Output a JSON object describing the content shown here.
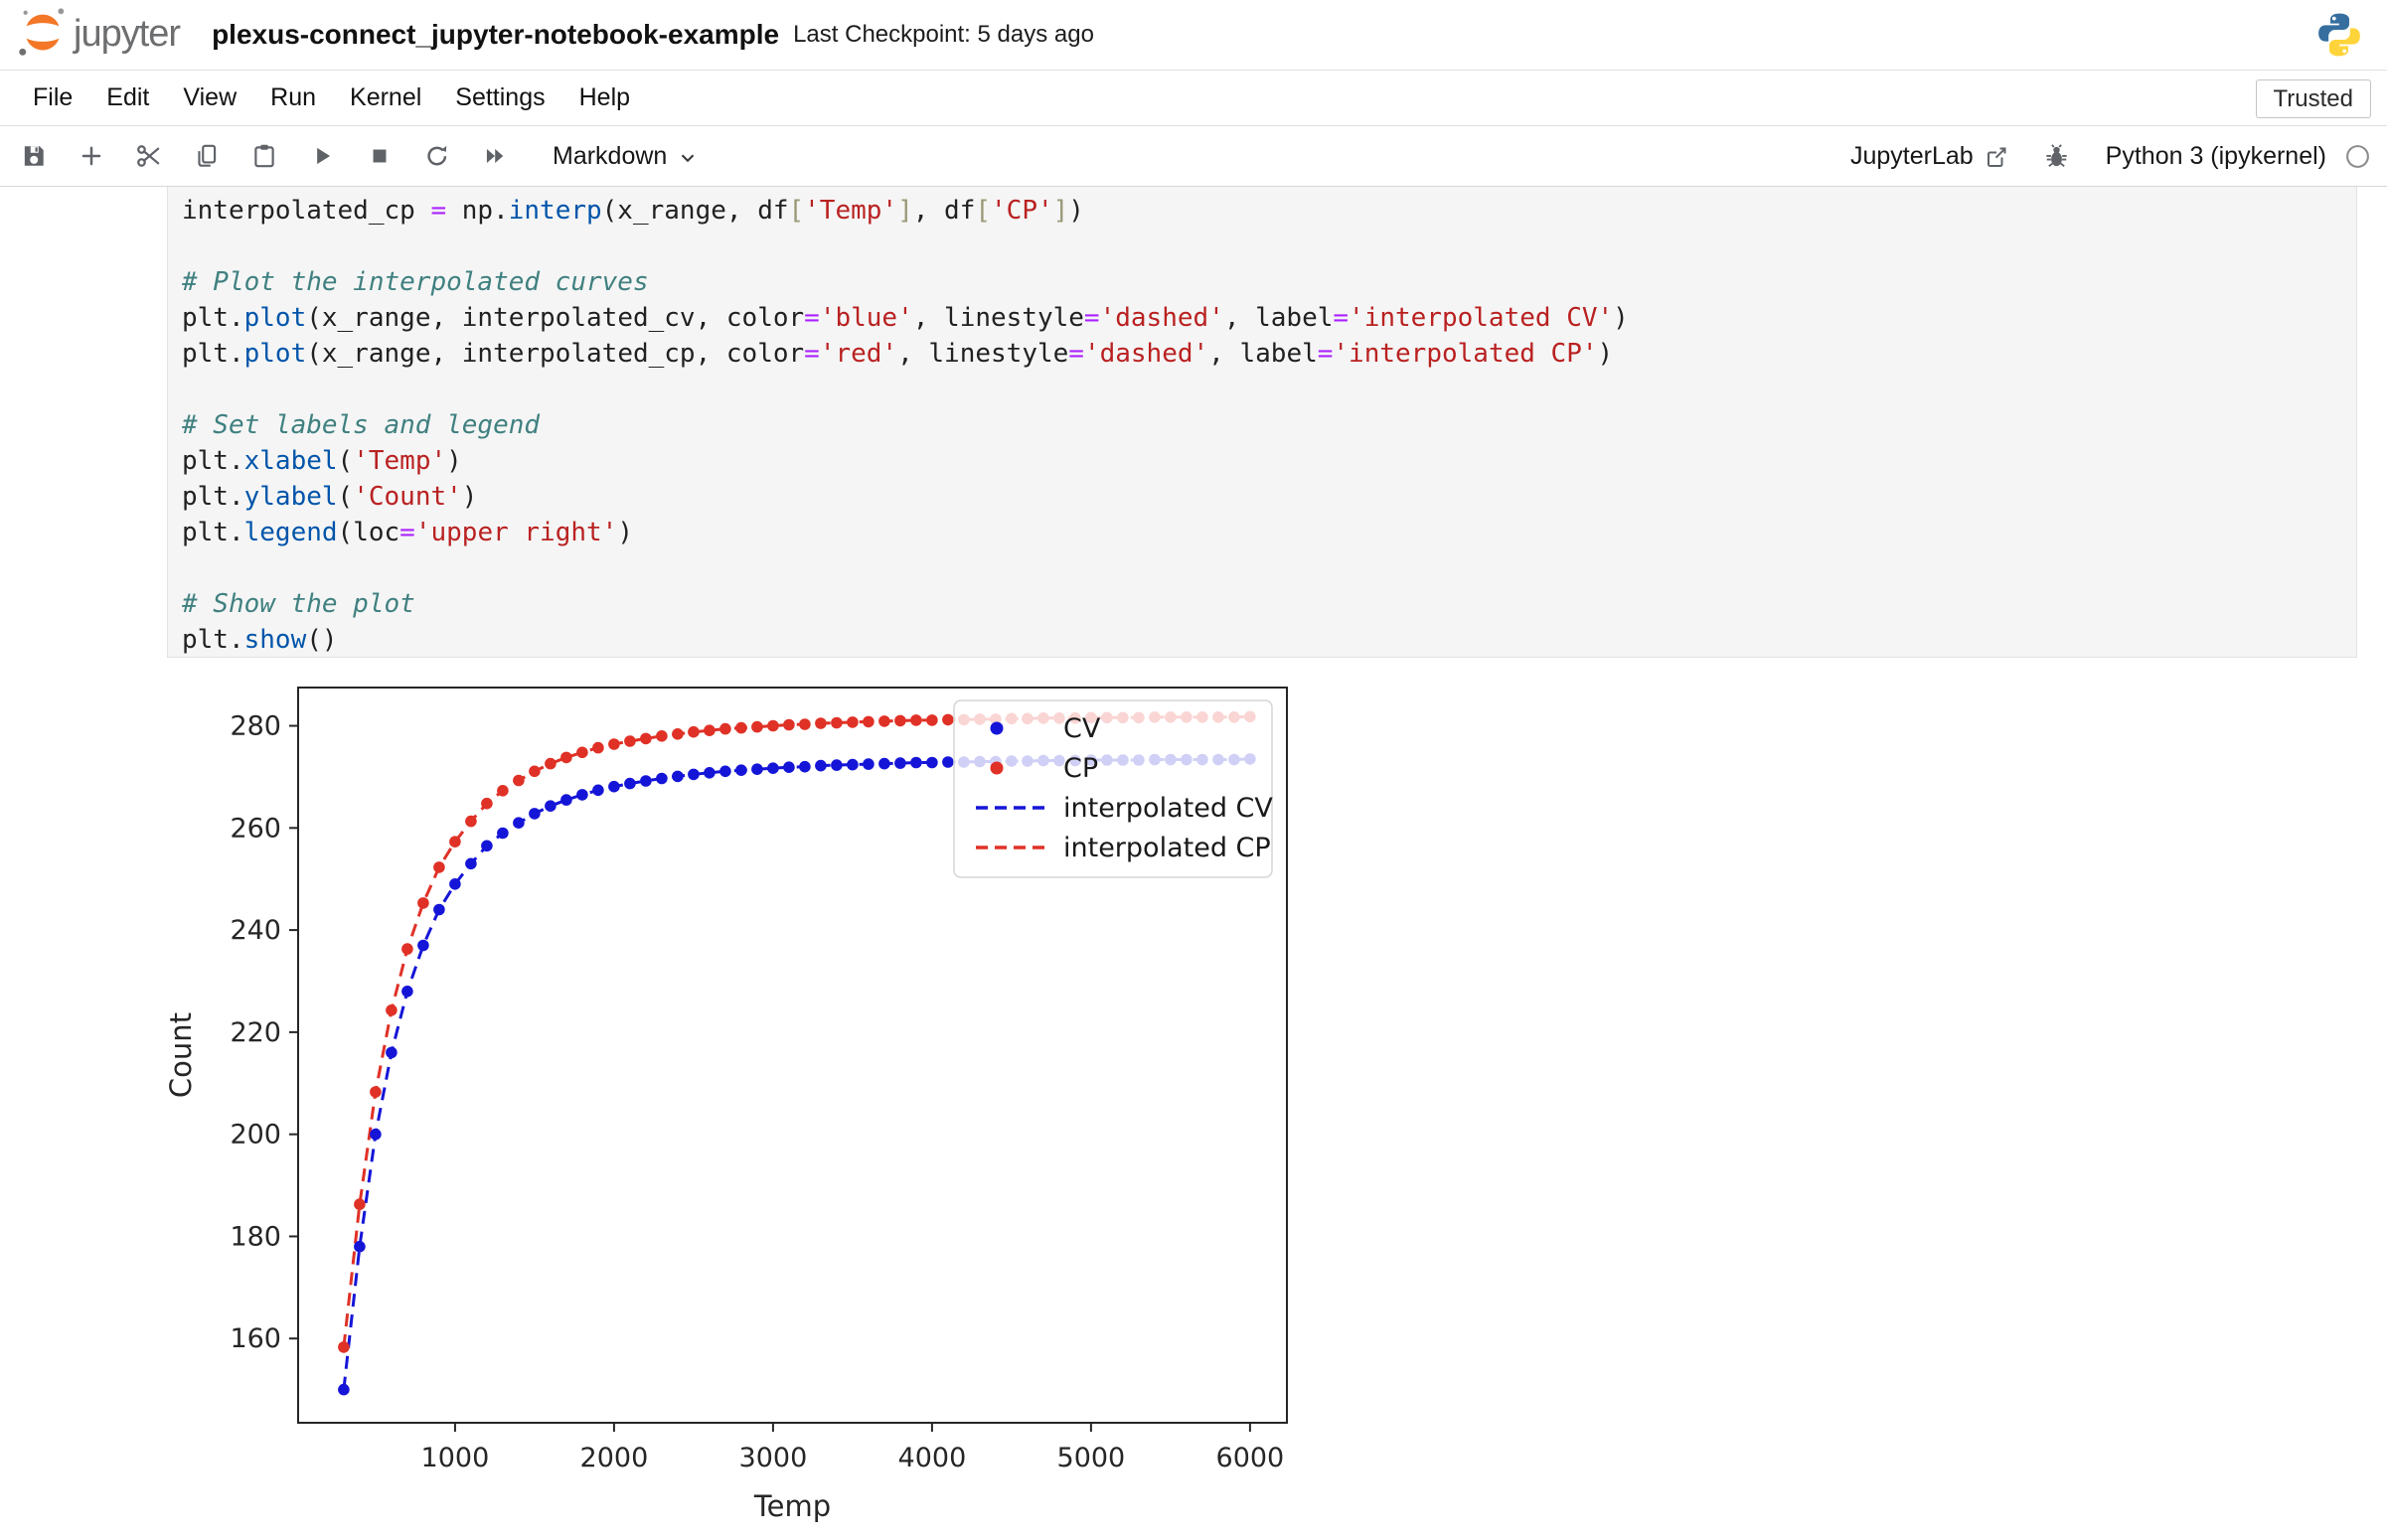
{
  "header": {
    "logo_text": "jupyter",
    "title": "plexus-connect_jupyter-notebook-example",
    "checkpoint": "Last Checkpoint: 5 days ago"
  },
  "menu": {
    "items": [
      "File",
      "Edit",
      "View",
      "Run",
      "Kernel",
      "Settings",
      "Help"
    ],
    "trusted_label": "Trusted"
  },
  "toolbar": {
    "icons": [
      "save",
      "insert-cell-below",
      "cut-cells",
      "copy-cells",
      "paste-cells",
      "run-cell",
      "interrupt-kernel",
      "restart-kernel",
      "restart-and-run-all"
    ],
    "cell_type": "Markdown",
    "jupyterlab_label": "JupyterLab",
    "kernel_name": "Python 3 (ipykernel)"
  },
  "cell": {
    "language": "python",
    "lines": [
      [
        [
          "p",
          "interpolated_cp "
        ],
        [
          "op",
          "="
        ],
        [
          "p",
          " np."
        ],
        [
          "fn",
          "interp"
        ],
        [
          "p",
          "(x_range, df"
        ],
        [
          "br",
          "["
        ],
        [
          "str",
          "'Temp'"
        ],
        [
          "br",
          "]"
        ],
        [
          "p",
          ", df"
        ],
        [
          "br",
          "["
        ],
        [
          "str",
          "'CP'"
        ],
        [
          "br",
          "]"
        ],
        [
          "p",
          ")"
        ]
      ],
      [],
      [
        [
          "com",
          "# Plot the interpolated curves"
        ]
      ],
      [
        [
          "p",
          "plt."
        ],
        [
          "fn",
          "plot"
        ],
        [
          "p",
          "(x_range, interpolated_cv, color"
        ],
        [
          "op",
          "="
        ],
        [
          "str",
          "'blue'"
        ],
        [
          "p",
          ", linestyle"
        ],
        [
          "op",
          "="
        ],
        [
          "str",
          "'dashed'"
        ],
        [
          "p",
          ", label"
        ],
        [
          "op",
          "="
        ],
        [
          "str",
          "'interpolated CV'"
        ],
        [
          "p",
          ")"
        ]
      ],
      [
        [
          "p",
          "plt."
        ],
        [
          "fn",
          "plot"
        ],
        [
          "p",
          "(x_range, interpolated_cp, color"
        ],
        [
          "op",
          "="
        ],
        [
          "str",
          "'red'"
        ],
        [
          "p",
          ", linestyle"
        ],
        [
          "op",
          "="
        ],
        [
          "str",
          "'dashed'"
        ],
        [
          "p",
          ", label"
        ],
        [
          "op",
          "="
        ],
        [
          "str",
          "'interpolated CP'"
        ],
        [
          "p",
          ")"
        ]
      ],
      [],
      [
        [
          "com",
          "# Set labels and legend"
        ]
      ],
      [
        [
          "p",
          "plt."
        ],
        [
          "fn",
          "xlabel"
        ],
        [
          "p",
          "("
        ],
        [
          "str",
          "'Temp'"
        ],
        [
          "p",
          ")"
        ]
      ],
      [
        [
          "p",
          "plt."
        ],
        [
          "fn",
          "ylabel"
        ],
        [
          "p",
          "("
        ],
        [
          "str",
          "'Count'"
        ],
        [
          "p",
          ")"
        ]
      ],
      [
        [
          "p",
          "plt."
        ],
        [
          "fn",
          "legend"
        ],
        [
          "p",
          "(loc"
        ],
        [
          "op",
          "="
        ],
        [
          "str",
          "'upper right'"
        ],
        [
          "p",
          ")"
        ]
      ],
      [],
      [
        [
          "com",
          "# Show the plot"
        ]
      ],
      [
        [
          "p",
          "plt."
        ],
        [
          "fn",
          "show"
        ],
        [
          "p",
          "()"
        ]
      ]
    ]
  },
  "chart_data": {
    "type": "scatter",
    "title": "",
    "xlabel": "Temp",
    "ylabel": "Count",
    "xlim": [
      13,
      6232
    ],
    "ylim": [
      143.5,
      287.5
    ],
    "x_ticks": [
      1000,
      2000,
      3000,
      4000,
      5000,
      6000
    ],
    "y_ticks": [
      160,
      180,
      200,
      220,
      240,
      260,
      280
    ],
    "grid": false,
    "temps": [
      300,
      400,
      500,
      600,
      700,
      800,
      900,
      1000,
      1100,
      1200,
      1300,
      1400,
      1500,
      1600,
      1700,
      1800,
      1900,
      2000,
      2100,
      2200,
      2300,
      2400,
      2500,
      2600,
      2700,
      2800,
      2900,
      3000,
      3100,
      3200,
      3300,
      3400,
      3500,
      3600,
      3700,
      3800,
      3900,
      4000,
      4100,
      4200,
      4300,
      4400,
      4500,
      4600,
      4700,
      4800,
      4900,
      5000,
      5100,
      5200,
      5300,
      5400,
      5500,
      5600,
      5700,
      5800,
      5900,
      6000
    ],
    "series": [
      {
        "name": "CV",
        "color": "#1515d8",
        "values": [
          150,
          178,
          200,
          216,
          228,
          237,
          244,
          249,
          253,
          256.5,
          259,
          261,
          262.8,
          264.3,
          265.5,
          266.5,
          267.4,
          268.1,
          268.7,
          269.2,
          269.7,
          270.1,
          270.5,
          270.8,
          271.1,
          271.3,
          271.5,
          271.7,
          271.9,
          272,
          272.2,
          272.3,
          272.4,
          272.5,
          272.6,
          272.7,
          272.8,
          272.8,
          272.9,
          272.9,
          273,
          273,
          273.1,
          273.1,
          273.2,
          273.2,
          273.2,
          273.3,
          273.3,
          273.3,
          273.3,
          273.4,
          273.4,
          273.4,
          273.4,
          273.4,
          273.4,
          273.5
        ]
      },
      {
        "name": "CP",
        "color": "#e03127",
        "values": [
          158.3,
          186.3,
          208.3,
          224.3,
          236.3,
          245.3,
          252.3,
          257.3,
          261.3,
          264.8,
          267.3,
          269.3,
          271.1,
          272.6,
          273.8,
          274.8,
          275.7,
          276.4,
          277,
          277.5,
          278,
          278.4,
          278.8,
          279.1,
          279.4,
          279.6,
          279.8,
          280,
          280.2,
          280.3,
          280.5,
          280.6,
          280.7,
          280.8,
          280.9,
          281,
          281.1,
          281.1,
          281.2,
          281.2,
          281.3,
          281.3,
          281.4,
          281.4,
          281.5,
          281.5,
          281.5,
          281.6,
          281.6,
          281.6,
          281.6,
          281.7,
          281.7,
          281.7,
          281.7,
          281.7,
          281.7,
          281.8
        ]
      }
    ],
    "legend": {
      "position": "upper right",
      "entries": [
        {
          "label": "CV",
          "type": "marker",
          "color": "#1515d8"
        },
        {
          "label": "CP",
          "type": "marker",
          "color": "#e03127"
        },
        {
          "label": "interpolated CV",
          "type": "dashed",
          "color": "#1515d8"
        },
        {
          "label": "interpolated CP",
          "type": "dashed",
          "color": "#e03127"
        }
      ]
    }
  }
}
